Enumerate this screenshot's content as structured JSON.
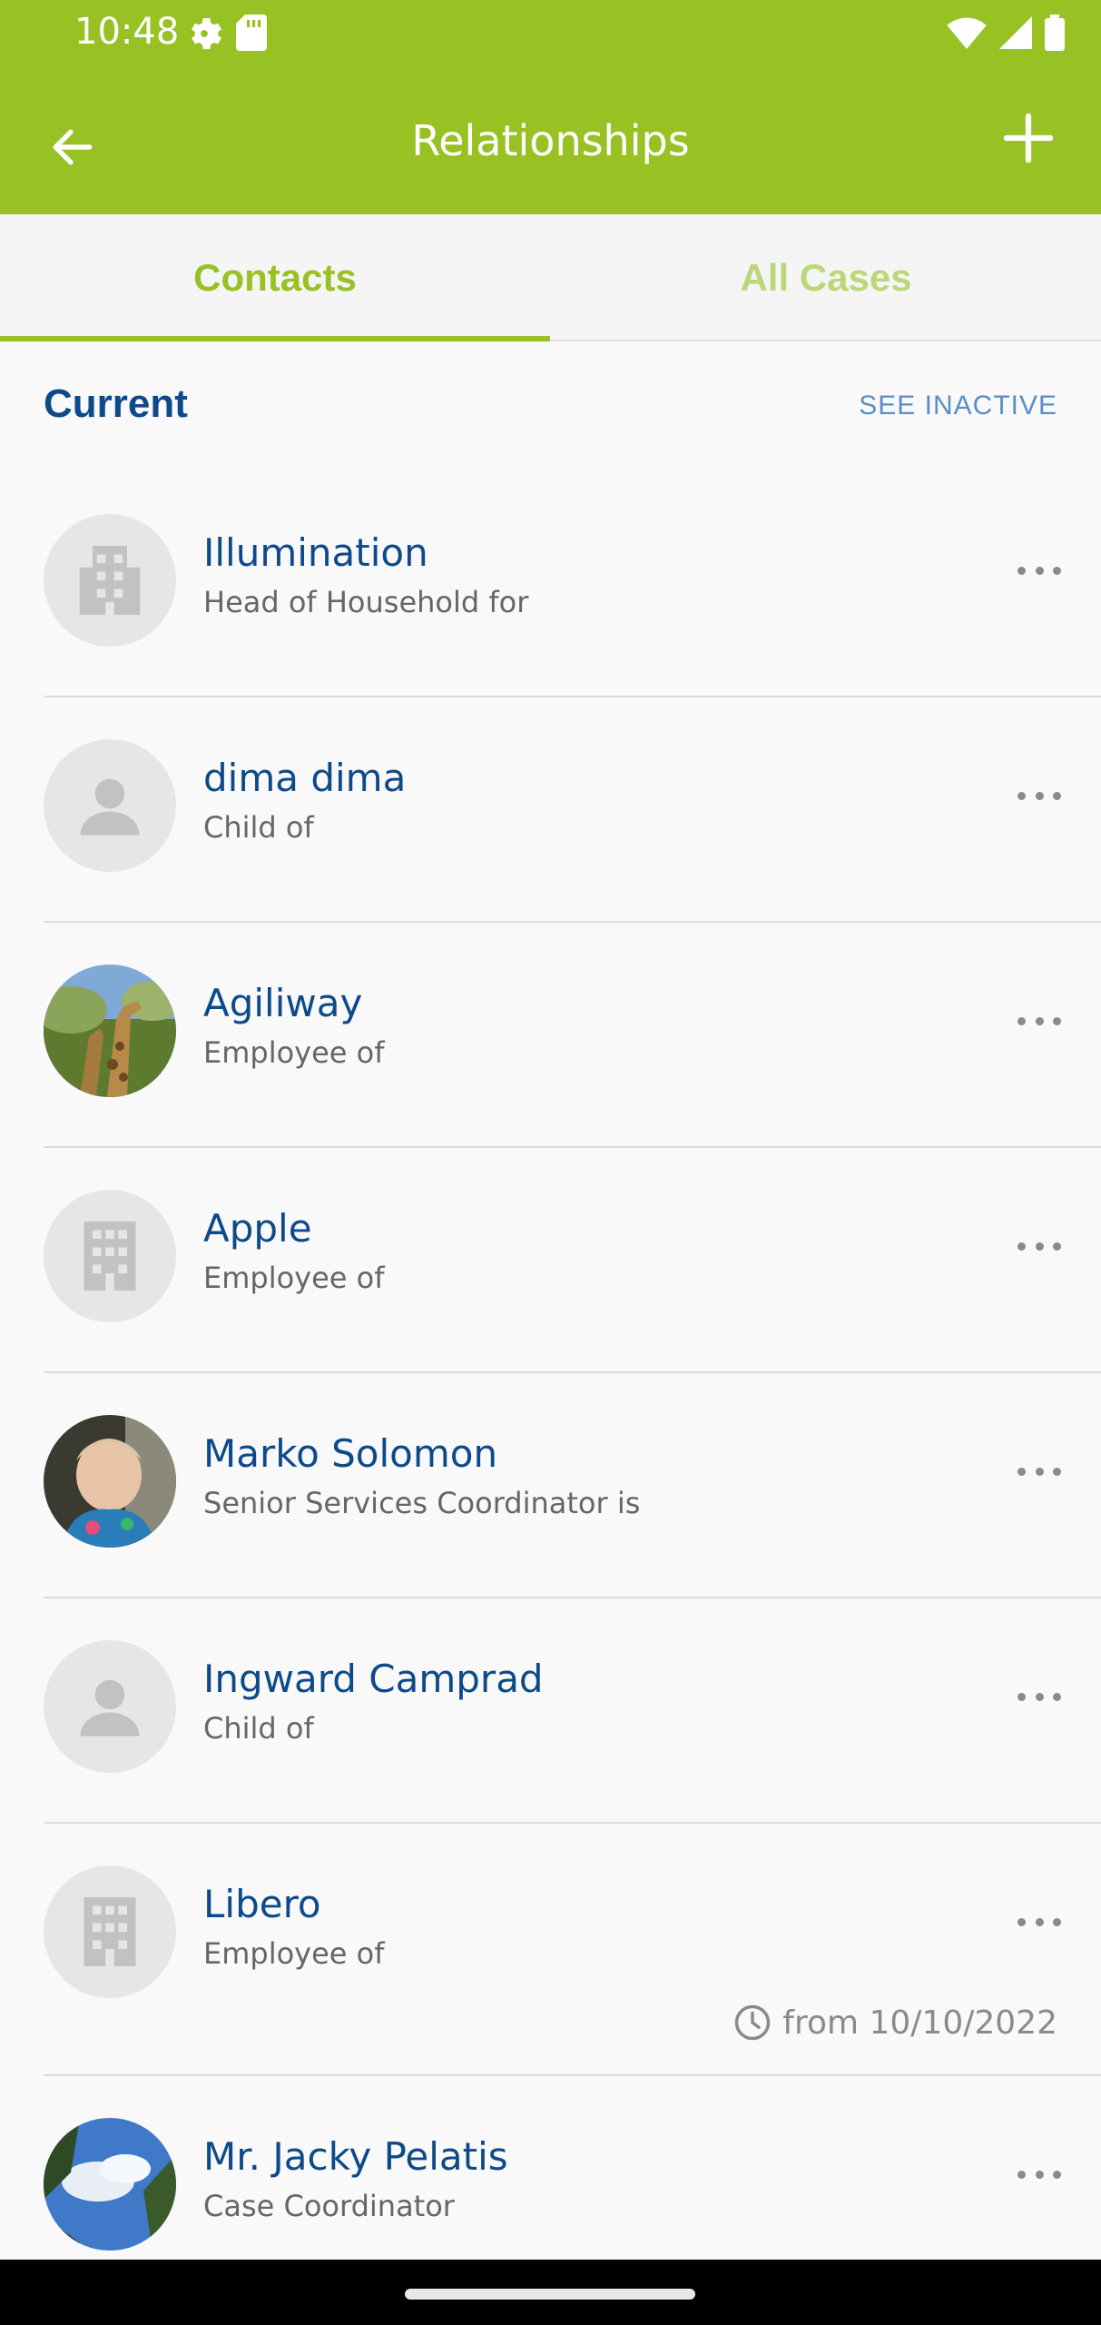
{
  "status_bar": {
    "time": "10:48",
    "icons": [
      "gear-icon",
      "sd-card-icon",
      "wifi-icon",
      "signal-icon",
      "battery-icon"
    ]
  },
  "app_bar": {
    "title": "Relationships",
    "back_icon": "arrow-left-icon",
    "add_icon": "plus-icon"
  },
  "tabs": [
    {
      "label": "Contacts",
      "selected": true
    },
    {
      "label": "All Cases",
      "selected": false
    }
  ],
  "section": {
    "title": "Current",
    "action": "SEE INACTIVE"
  },
  "contacts": [
    {
      "name": "Illumination",
      "relation": "Head of Household for",
      "avatar": "building-icon"
    },
    {
      "name": "dima dima",
      "relation": "Child of",
      "avatar": "person-icon"
    },
    {
      "name": "Agiliway",
      "relation": "Employee of",
      "avatar": "photo-giraffe"
    },
    {
      "name": "Apple",
      "relation": "Employee of",
      "avatar": "building-icon"
    },
    {
      "name": "Marko Solomon",
      "relation": "Senior Services Coordinator is",
      "avatar": "photo-child"
    },
    {
      "name": "Ingward Camprad",
      "relation": "Child of",
      "avatar": "person-icon"
    },
    {
      "name": "Libero",
      "relation": "Employee of",
      "avatar": "building-icon",
      "date": "from 10/10/2022"
    },
    {
      "name": "Mr. Jacky Pelatis",
      "relation": "Case Coordinator",
      "avatar": "photo-sky"
    }
  ],
  "colors": {
    "brand_green": "#98c123",
    "name_blue": "#0d4a8a",
    "link_blue": "#5b8ec8"
  }
}
